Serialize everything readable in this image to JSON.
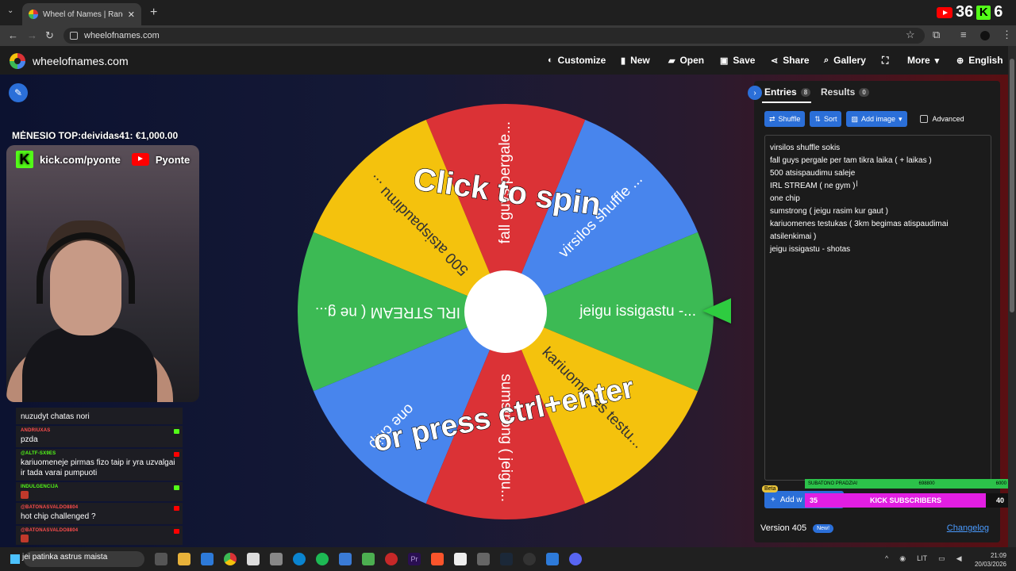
{
  "browser": {
    "tab_title": "Wheel of Names | Random nam",
    "url": "wheelofnames.com"
  },
  "stream_counters": {
    "youtube_count": "36",
    "kick_count": "6"
  },
  "site": {
    "brand": "wheelofnames.com",
    "menu": {
      "customize": "Customize",
      "new": "New",
      "open": "Open",
      "save": "Save",
      "share": "Share",
      "gallery": "Gallery",
      "more": "More",
      "language": "English"
    }
  },
  "overlay": {
    "top_banner": "MĖNESIO TOP:deividas41: €1,000.00",
    "kick_url": "kick.com/pyonte",
    "youtube_name": "Pyonte"
  },
  "chat": [
    {
      "user": "",
      "text": "nuzudyt chatas nori",
      "user_color": "#ffffff",
      "platform": ""
    },
    {
      "user": "ANDRIUXAS",
      "text": "pzda",
      "user_color": "#ff4d4d",
      "platform": "kick"
    },
    {
      "user": "@ALTF-SX9ES",
      "text": "kariuomeneje pirmas fizo taip ir yra uzvalgai ir tada varai pumpuoti",
      "user_color": "#53fc18",
      "platform": "youtube"
    },
    {
      "user": "INDULGENCIJA",
      "text": "",
      "user_color": "#53fc18",
      "platform": "kick"
    },
    {
      "user": "@BATONASVALDO8804",
      "text": "hot chip challenged ?",
      "user_color": "#ff4d4d",
      "platform": "youtube"
    },
    {
      "user": "@BATONASVALDO8804",
      "text": "",
      "user_color": "#ff4d4d",
      "platform": "youtube"
    }
  ],
  "taskbar_chat_text": "jei patinka astrus maista",
  "wheel": {
    "center_text_top": "Click to spin",
    "center_text_bottom": "or press ctrl+enter",
    "segments": [
      {
        "label": "jeigu issigastu -...",
        "color": "#3cba54"
      },
      {
        "label": "virsilos shuffle ...",
        "color": "#4885ed"
      },
      {
        "label": "fall guys pergale...",
        "color": "#db3236"
      },
      {
        "label": "500 atsispaudimu ...",
        "color": "#f4c20d"
      },
      {
        "label": "IRL STREAM ( ne g...",
        "color": "#3cba54"
      },
      {
        "label": "one chip",
        "color": "#4885ed"
      },
      {
        "label": "sumstrong ( jeigu...",
        "color": "#db3236"
      },
      {
        "label": "kariuomenes testu...",
        "color": "#f4c20d"
      }
    ]
  },
  "panel": {
    "tab_entries": "Entries",
    "entries_count": "8",
    "tab_results": "Results",
    "results_count": "0",
    "shuffle": "Shuffle",
    "sort": "Sort",
    "add_image": "Add image",
    "advanced": "Advanced",
    "entries": [
      "virsilos shuffle sokis",
      "fall guys pergale per tam tikra laika ( + laikas )",
      "500 atsispaudimu saleje",
      "IRL STREAM ( ne gym )",
      "one chip",
      "sumstrong ( jeigu rasim kur gaut )",
      "kariuomenes testukas ( 3km begimas atispaudimai atsilenkimai )",
      "jeigu issigastu - shotas"
    ],
    "beta": "Beta",
    "add_button": "Add w",
    "version": "Version 405",
    "new_badge": "New!",
    "changelog": "Changelog"
  },
  "sub_goal": {
    "label": "SUBATONO PRADZIA!",
    "mid": "698800",
    "right": "6000",
    "sub_left": "35",
    "sub_label": "KICK SUBSCRIBERS",
    "sub_right": "40",
    "progress": 0.875
  },
  "tray": {
    "lang": "LIT",
    "time": "21:09",
    "date": "20/03/2026"
  }
}
